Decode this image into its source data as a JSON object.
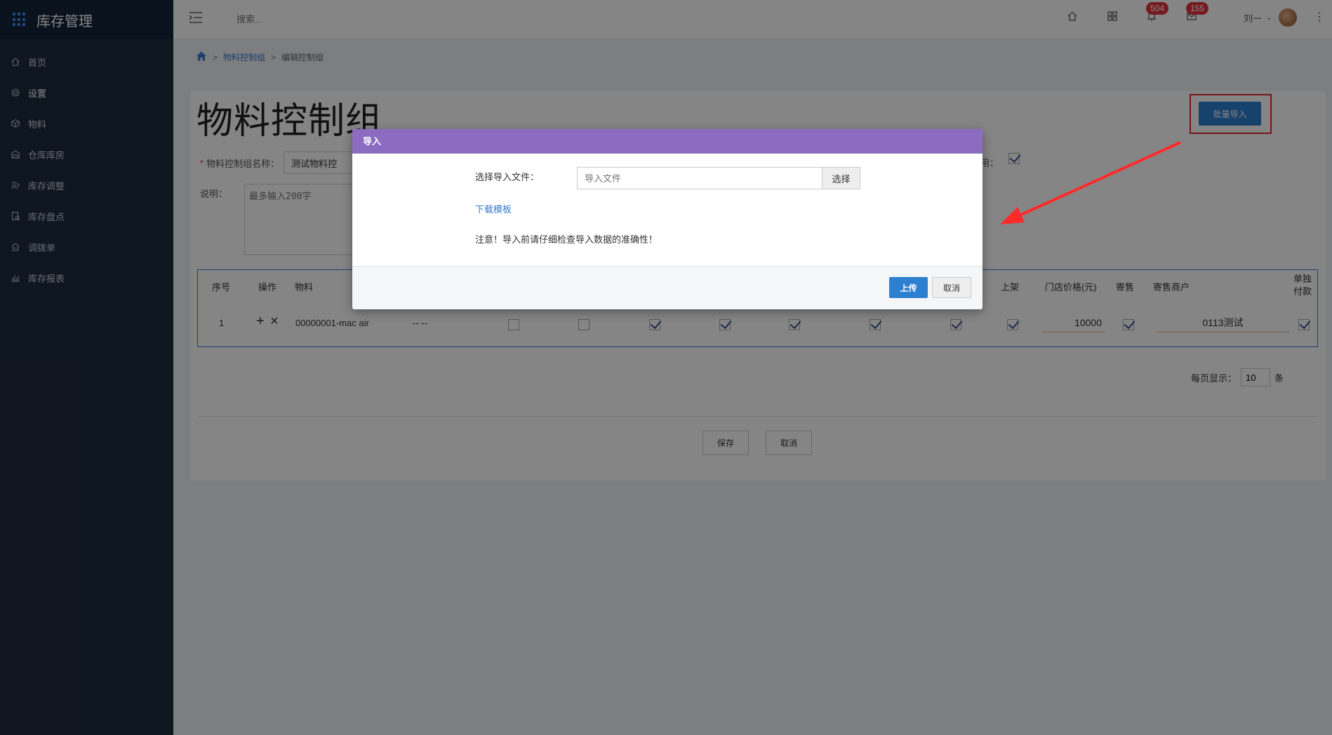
{
  "app": {
    "title": "库存管理"
  },
  "sidebar": {
    "items": [
      {
        "label": "首页",
        "icon": "home-icon"
      },
      {
        "label": "设置",
        "icon": "gear-icon"
      },
      {
        "label": "物料",
        "icon": "cube-icon"
      },
      {
        "label": "仓库库房",
        "icon": "warehouse-icon"
      },
      {
        "label": "库存调整",
        "icon": "adjust-icon"
      },
      {
        "label": "库存盘点",
        "icon": "inventory-check-icon"
      },
      {
        "label": "调拨单",
        "icon": "transfer-icon"
      },
      {
        "label": "库存报表",
        "icon": "bar-chart-icon"
      }
    ]
  },
  "header": {
    "search_placeholder": "搜索...",
    "notifications_count": "504",
    "messages_count": "155",
    "user_name": "刘一"
  },
  "breadcrumb": {
    "parent": "物料控制组",
    "current": "编辑控制组"
  },
  "page": {
    "title": "物料控制组",
    "import_button": "批量导入",
    "name_label": "物料控制组名称：",
    "name_value": "测试物料控",
    "desc_label": "说明：",
    "desc_placeholder": "最多输入200字",
    "enable_label": "用："
  },
  "table": {
    "headers": {
      "index": "序号",
      "action": "操作",
      "material": "物料",
      "shelf": "上架",
      "store_price": "门店价格(元)",
      "consign": "寄售",
      "consign_merchant": "寄售商户",
      "separate_pay": "单独付款"
    },
    "row": {
      "index": "1",
      "add_action": "+",
      "remove_action": "×",
      "material": "00000001-mac air",
      "spec": "-- --",
      "price": "10000",
      "merchant": "0113测试"
    }
  },
  "pager": {
    "label": "每页显示：",
    "value": "10",
    "unit": "条"
  },
  "form_actions": {
    "save": "保存",
    "cancel": "取消"
  },
  "modal": {
    "title": "导入",
    "file_label": "选择导入文件：",
    "file_placeholder": "导入文件",
    "choose_button": "选择",
    "template_link": "下载模板",
    "notice": "注意！导入前请仔细检查导入数据的准确性！",
    "upload_button": "上传",
    "cancel_button": "取消"
  },
  "colors": {
    "sidebar": "#1c2b3f",
    "primary": "#2d7fd0",
    "modal_header": "#8b6cc0",
    "highlight": "#e02b2b"
  }
}
